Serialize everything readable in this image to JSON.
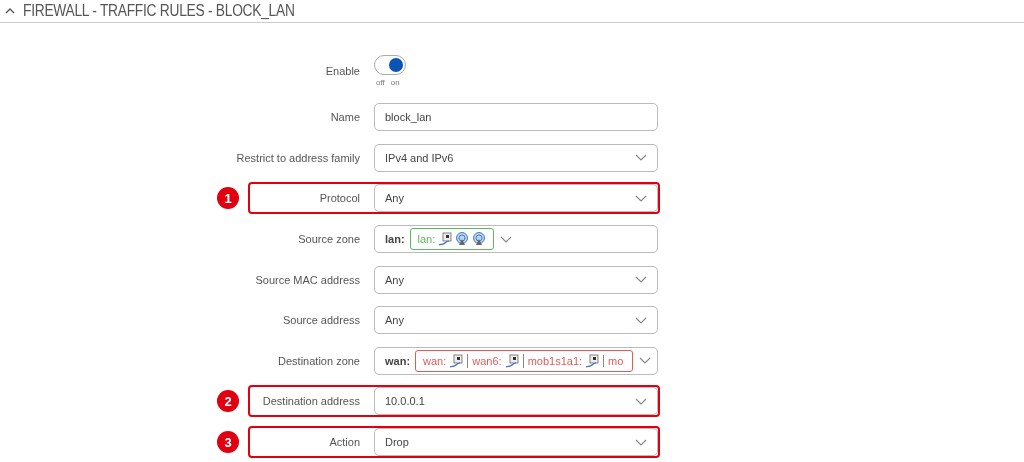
{
  "section": {
    "title": "FIREWALL - TRAFFIC RULES - BLOCK_LAN",
    "expanded": true
  },
  "rows": [
    {
      "kind": "toggle",
      "label": "Enable",
      "on": true,
      "off_label": "off",
      "on_label": "on"
    },
    {
      "kind": "text",
      "label": "Name",
      "value": "block_lan"
    },
    {
      "kind": "select",
      "label": "Restrict to address family",
      "value": "IPv4 and IPv6"
    },
    {
      "kind": "select",
      "label": "Protocol",
      "value": "Any",
      "marker": "1"
    },
    {
      "kind": "zone",
      "label": "Source zone",
      "zone": "lan:",
      "color": "#5cb85c",
      "segments": [
        {
          "name": "lan:",
          "icons": [
            {
              "kind": "wired"
            },
            {
              "kind": "wireless"
            },
            {
              "kind": "wireless"
            }
          ]
        }
      ]
    },
    {
      "kind": "select",
      "label": "Source MAC address",
      "value": "Any"
    },
    {
      "kind": "select",
      "label": "Source address",
      "value": "Any"
    },
    {
      "kind": "zone",
      "label": "Destination zone",
      "zone": "wan:",
      "color": "#e05a5a",
      "segments": [
        {
          "name": "wan:",
          "icons": [
            {
              "kind": "wired"
            }
          ]
        },
        {
          "name": "wan6:",
          "icons": [
            {
              "kind": "wired"
            }
          ]
        },
        {
          "name": "mob1s1a1:",
          "icons": [
            {
              "kind": "wired"
            }
          ]
        },
        {
          "name": "mo"
        }
      ]
    },
    {
      "kind": "select",
      "label": "Destination address",
      "value": "10.0.0.1",
      "marker": "2"
    },
    {
      "kind": "select",
      "label": "Action",
      "value": "Drop",
      "marker": "3"
    }
  ]
}
